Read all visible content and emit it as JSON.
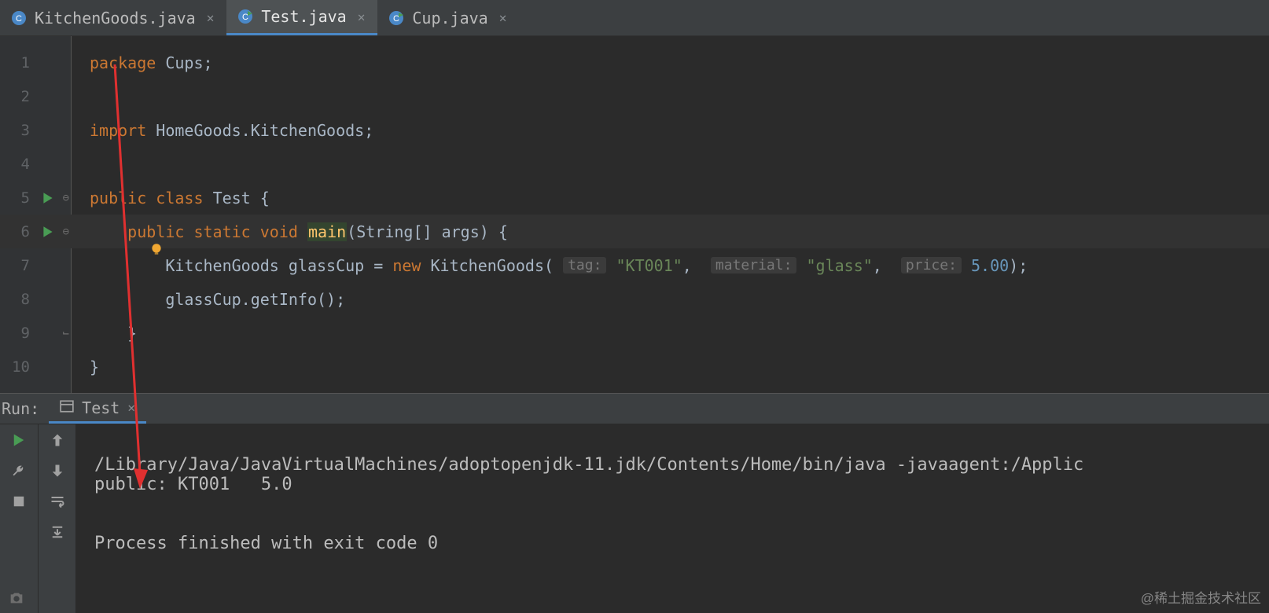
{
  "tabs": [
    {
      "label": "KitchenGoods.java",
      "active": false
    },
    {
      "label": "Test.java",
      "active": true
    },
    {
      "label": "Cup.java",
      "active": false
    }
  ],
  "gutter": {
    "lines": [
      "1",
      "2",
      "3",
      "4",
      "5",
      "6",
      "7",
      "8",
      "9",
      "10"
    ],
    "run_markers": [
      5,
      6
    ],
    "fold_markers": [
      5,
      6,
      9
    ]
  },
  "code": {
    "l1": {
      "kw": "package",
      "rest": " Cups;"
    },
    "l3": {
      "kw": "import",
      "rest": " HomeGoods.KitchenGoods;"
    },
    "l5": {
      "kw1": "public",
      "kw2": "class",
      "name": "Test",
      "brace": " {"
    },
    "l6": {
      "kw1": "public",
      "kw2": "static",
      "kw3": "void",
      "method": "main",
      "params": "(String[] args) {"
    },
    "l7": {
      "type": "KitchenGoods",
      "var": " glassCup = ",
      "kw": "new",
      "ctor": " KitchenGoods(",
      "hint1": "tag:",
      "str1": "\"KT001\"",
      "c1": ",  ",
      "hint2": "material:",
      "str2": "\"glass\"",
      "c2": ",  ",
      "hint3": "price:",
      "num": "5.00",
      "end": ");"
    },
    "l8": {
      "call": "glassCup.",
      "method": "getInfo",
      "end": "();"
    },
    "l9": {
      "brace": "}"
    },
    "l10": {
      "brace": "}"
    }
  },
  "runbar": {
    "label": "Run:",
    "tab": "Test"
  },
  "console": {
    "cmd": "/Library/Java/JavaVirtualMachines/adoptopenjdk-11.jdk/Contents/Home/bin/java -javaagent:/Applic",
    "out": "public: KT001   5.0",
    "exit": "Process finished with exit code 0"
  },
  "watermark": "@稀土掘金技术社区"
}
